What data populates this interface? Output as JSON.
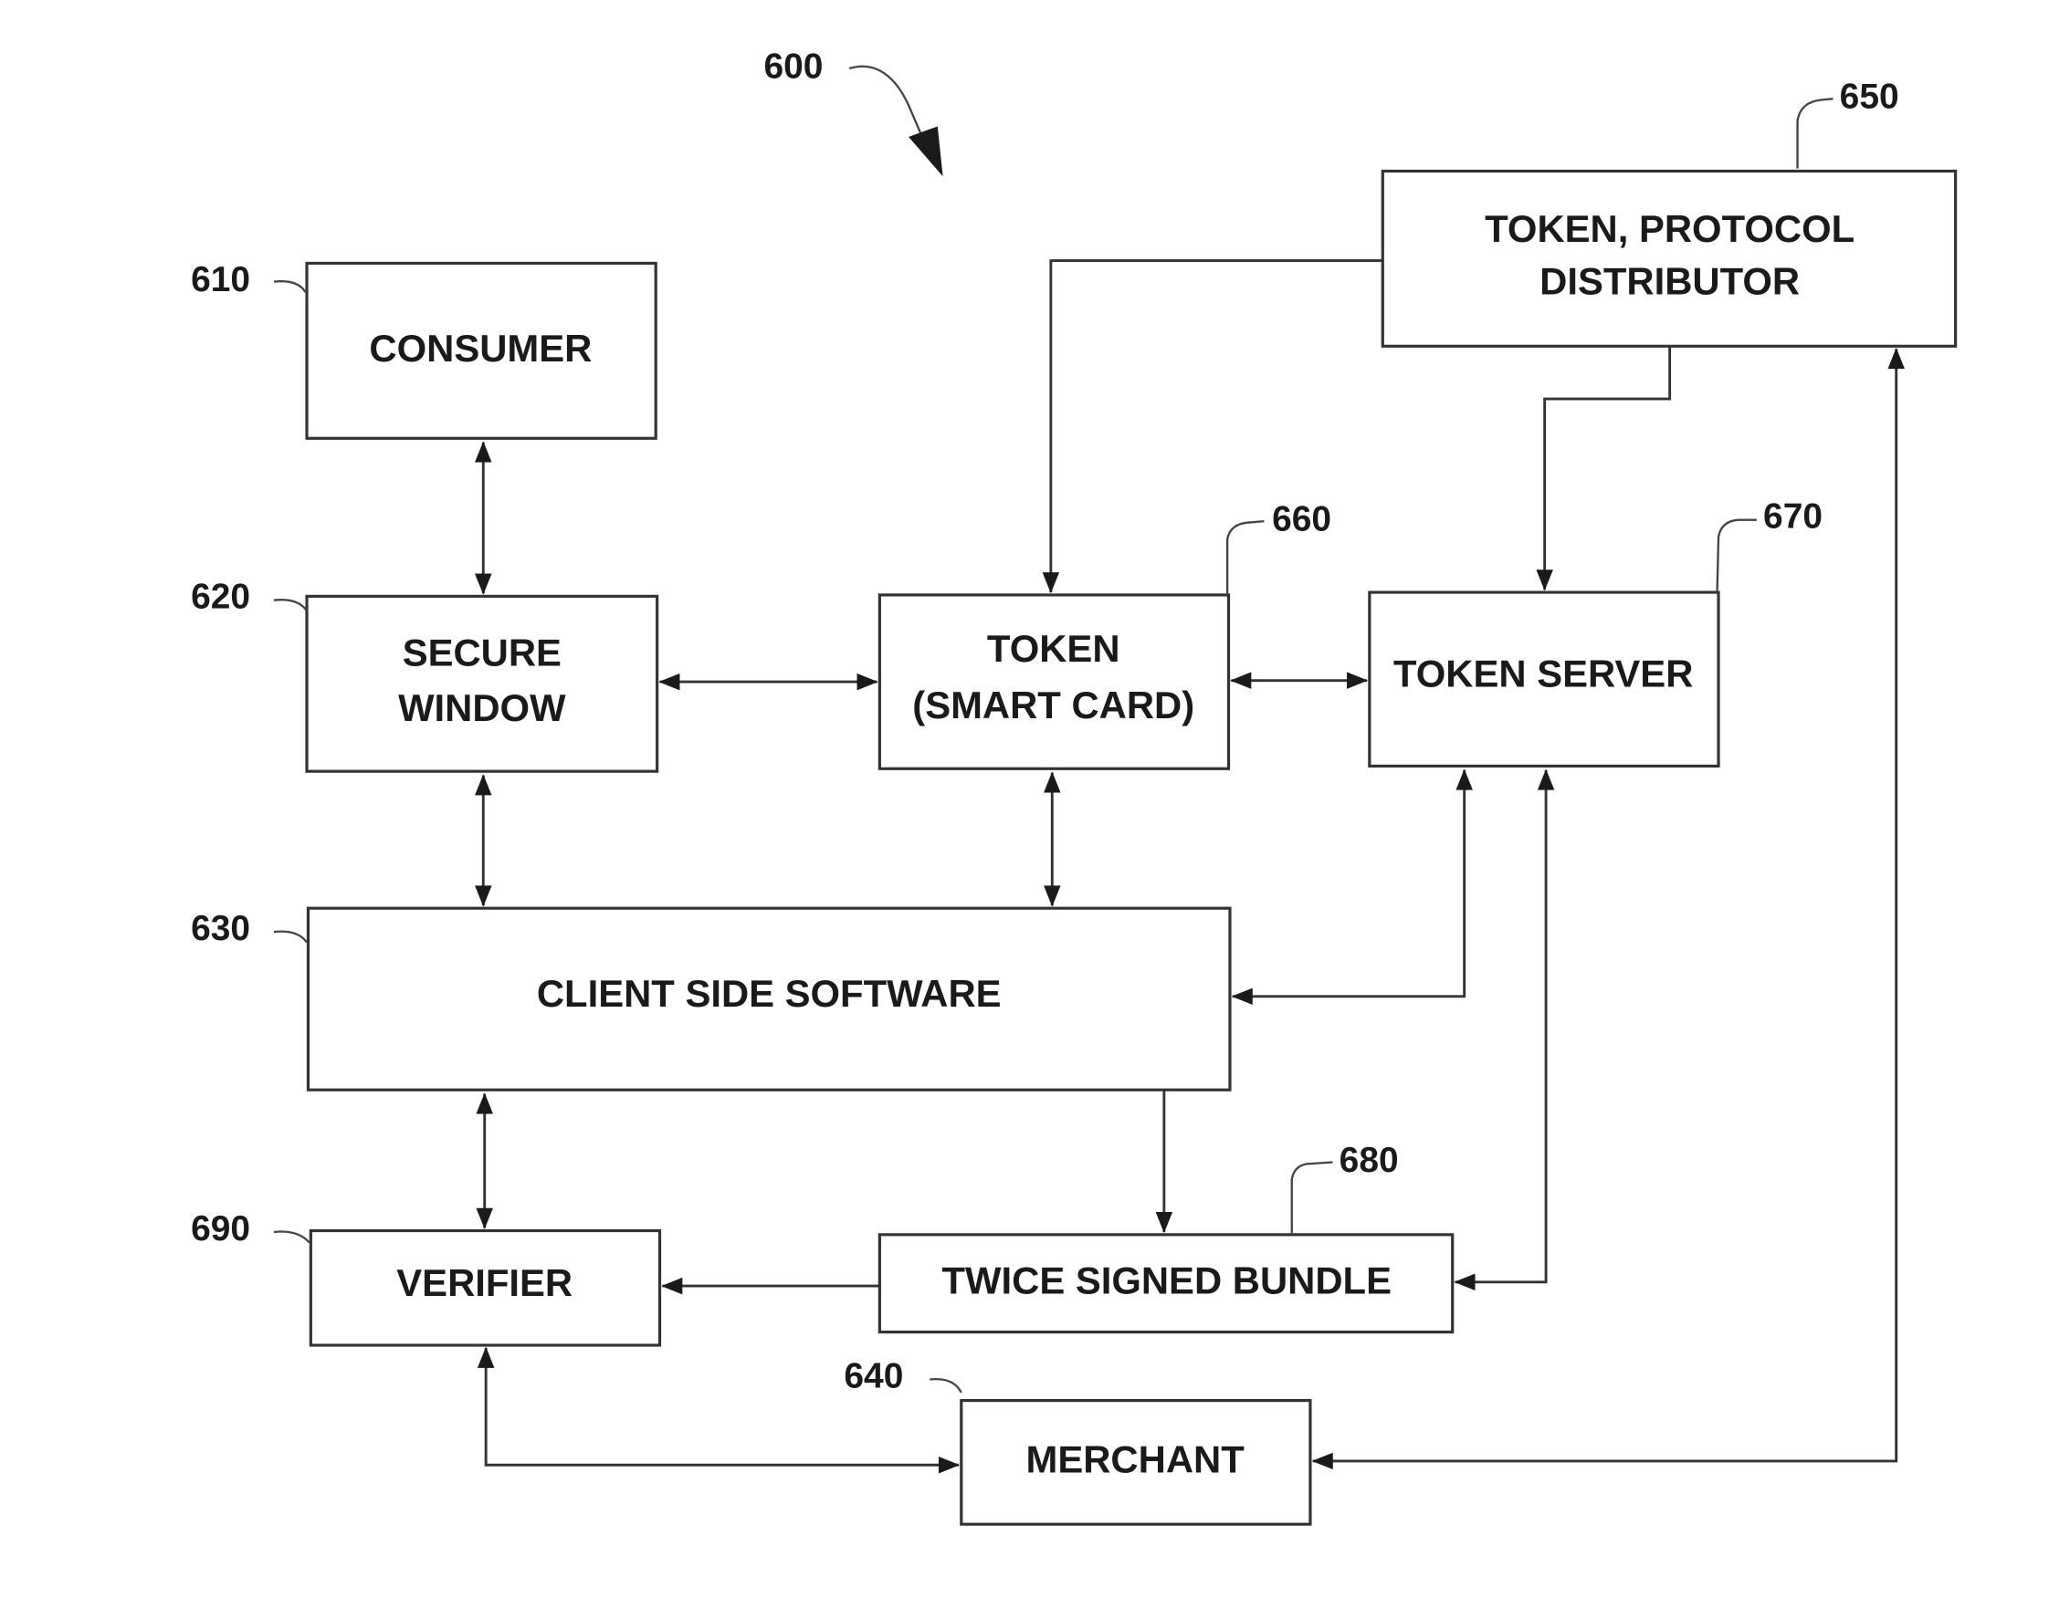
{
  "figure": {
    "reference": "600",
    "blocks": {
      "consumer": {
        "ref": "610",
        "lines": [
          "CONSUMER"
        ]
      },
      "secure_window": {
        "ref": "620",
        "lines": [
          "SECURE",
          "WINDOW"
        ]
      },
      "client_side_software": {
        "ref": "630",
        "lines": [
          "CLIENT SIDE SOFTWARE"
        ]
      },
      "merchant": {
        "ref": "640",
        "lines": [
          "MERCHANT"
        ]
      },
      "token_protocol_distributor": {
        "ref": "650",
        "lines": [
          "TOKEN, PROTOCOL",
          "DISTRIBUTOR"
        ]
      },
      "token_smart_card": {
        "ref": "660",
        "lines": [
          "TOKEN",
          "(SMART CARD)"
        ]
      },
      "token_server": {
        "ref": "670",
        "lines": [
          "TOKEN SERVER"
        ]
      },
      "twice_signed_bundle": {
        "ref": "680",
        "lines": [
          "TWICE SIGNED BUNDLE"
        ]
      },
      "verifier": {
        "ref": "690",
        "lines": [
          "VERIFIER"
        ]
      }
    },
    "connections": [
      {
        "from": "consumer",
        "to": "secure_window",
        "direction": "bidirectional"
      },
      {
        "from": "secure_window",
        "to": "token_smart_card",
        "direction": "bidirectional"
      },
      {
        "from": "token_smart_card",
        "to": "token_server",
        "direction": "bidirectional"
      },
      {
        "from": "token_protocol_distributor",
        "to": "token_smart_card",
        "direction": "forward"
      },
      {
        "from": "token_protocol_distributor",
        "to": "token_server",
        "direction": "forward"
      },
      {
        "from": "secure_window",
        "to": "client_side_software",
        "direction": "bidirectional"
      },
      {
        "from": "token_smart_card",
        "to": "client_side_software",
        "direction": "bidirectional"
      },
      {
        "from": "token_server",
        "to": "client_side_software",
        "direction": "bidirectional"
      },
      {
        "from": "token_server",
        "to": "twice_signed_bundle",
        "direction": "bidirectional"
      },
      {
        "from": "client_side_software",
        "to": "twice_signed_bundle",
        "direction": "forward"
      },
      {
        "from": "client_side_software",
        "to": "verifier",
        "direction": "bidirectional"
      },
      {
        "from": "twice_signed_bundle",
        "to": "verifier",
        "direction": "forward"
      },
      {
        "from": "verifier",
        "to": "merchant",
        "direction": "bidirectional"
      },
      {
        "from": "merchant",
        "to": "token_protocol_distributor",
        "direction": "bidirectional"
      }
    ]
  }
}
